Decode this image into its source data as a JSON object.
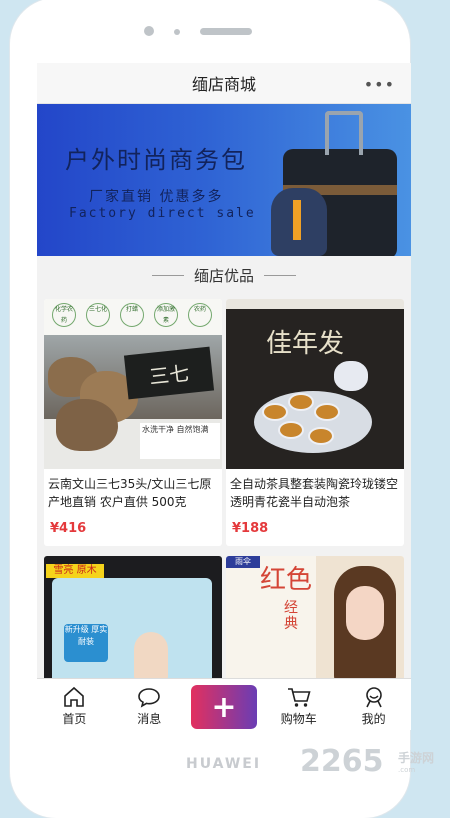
{
  "app": {
    "title": "缅店商城",
    "more_icon": "more-dots-icon"
  },
  "banner": {
    "headline": "户外时尚商务包",
    "subheadline": "厂家直销 优惠多多",
    "subheadline_en": "Factory direct sale"
  },
  "section": {
    "title": "缅店优品"
  },
  "products": [
    {
      "name": "云南文山三七35头/文山三七原产地直销 农户直供 500克",
      "price": "¥416",
      "image_text": "三七",
      "badges": [
        "化学农药",
        "三七化",
        "打蜡",
        "添加激素",
        "农药"
      ],
      "tag": "水洗干净 自然饱满"
    },
    {
      "name": "全自动茶具整套装陶瓷玲珑镂空透明青花瓷半自动泡茶",
      "price": "¥188",
      "image_text": "佳年发"
    },
    {
      "name": "",
      "price": "",
      "brand": "雪亮 原木",
      "panel": "新升级 厚实耐装"
    },
    {
      "name": "",
      "price": "",
      "image_text": "红色",
      "vertical_text": "经典",
      "logo": "雨伞"
    }
  ],
  "tabbar": [
    {
      "label": "首页",
      "icon": "home-icon"
    },
    {
      "label": "消息",
      "icon": "chat-bubble-icon"
    },
    {
      "label": "+",
      "icon": "plus-icon"
    },
    {
      "label": "购物车",
      "icon": "cart-icon"
    },
    {
      "label": "我的",
      "icon": "person-icon"
    }
  ],
  "device": {
    "brand": "HUAWEI"
  },
  "watermark": {
    "number": "2265",
    "text": "手游网",
    "url": ".com"
  },
  "colors": {
    "price": "#e4393c",
    "fab_start": "#e2305f",
    "fab_end": "#6a3db4",
    "banner_blue": "#2346c9"
  }
}
